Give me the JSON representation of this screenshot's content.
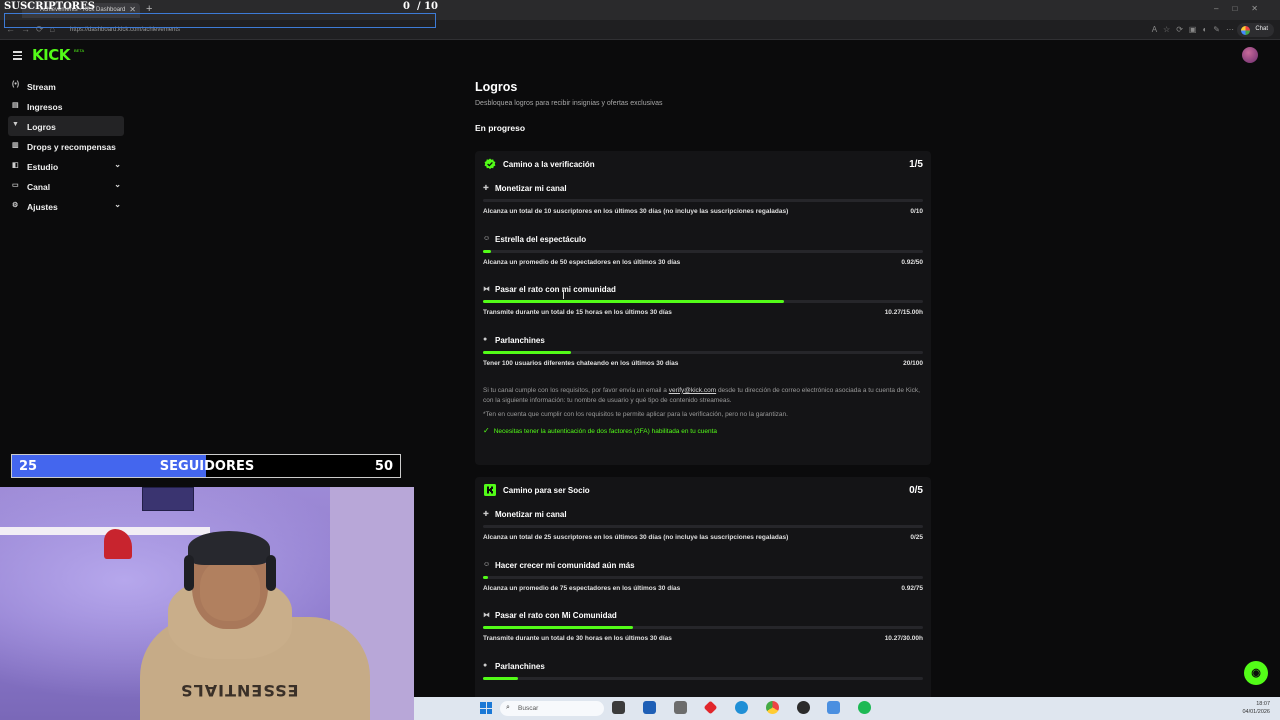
{
  "overlay_subs": {
    "label": "SUSCRIPTORES",
    "current": "0",
    "sep": "/",
    "goal": "10"
  },
  "browser": {
    "tab_title": "Achievements - Kick Dashboard",
    "url": "https://dashboard.kick.com/achievements",
    "chat_label": "Chat"
  },
  "kick": {
    "logo": "KICK",
    "logo_beta": "BETA"
  },
  "sidebar": {
    "items": [
      {
        "label": "Stream",
        "icon": "broadcast-icon",
        "glyph": "((•))"
      },
      {
        "label": "Ingresos",
        "icon": "wallet-icon",
        "glyph": "▤"
      },
      {
        "label": "Logros",
        "icon": "trophy-icon",
        "glyph": "🏆"
      },
      {
        "label": "Drops y recompensas",
        "icon": "gift-icon",
        "glyph": "▥"
      },
      {
        "label": "Estudio",
        "icon": "studio-icon",
        "glyph": "◧"
      },
      {
        "label": "Canal",
        "icon": "channel-icon",
        "glyph": "▭"
      },
      {
        "label": "Ajustes",
        "icon": "gear-icon",
        "glyph": "⚙"
      }
    ]
  },
  "page": {
    "title": "Logros",
    "subtitle": "Desbloquea logros para recibir insignias y ofertas exclusivas",
    "section": "En progreso"
  },
  "cards": [
    {
      "title": "Camino a la verificación",
      "count": "1/5",
      "badge_color": "#53fc18",
      "tasks": [
        {
          "name": "Monetizar mi canal",
          "icon": "✚",
          "desc": "Alcanza un total de 10 suscriptores en los últimos 30 días (no incluye las suscripciones regaladas)",
          "value": "0/10",
          "progress": 0.0
        },
        {
          "name": "Estrella del espectáculo",
          "icon": "☺",
          "desc": "Alcanza un promedio de 50 espectadores en los últimos 30 días",
          "value": "0.92/50",
          "progress": 0.018
        },
        {
          "name": "Pasar el rato con mi comunidad",
          "icon": "⧓",
          "desc": "Transmite durante un total de 15 horas en los últimos 30 días",
          "value": "10.27/15.00h",
          "progress": 0.685
        },
        {
          "name": "Parlanchines",
          "icon": "●",
          "desc": "Tener 100 usuarios diferentes chateando en los últimos 30 días",
          "value": "20/100",
          "progress": 0.2
        }
      ],
      "info": {
        "text1": "Si tu canal cumple con los requisitos, por favor envía un email a ",
        "email": "verify@kick.com",
        "text2": " desde tu dirección de correo electrónico asociada a tu cuenta de Kick, con la siguiente información: tu nombre de usuario y qué tipo de contenido streameas.",
        "note": "*Ten en cuenta que cumplir con los requisitos te permite aplicar para la verificación, pero no la garantizan.",
        "twofa": "Necesitas tener la autenticación de dos factores (2FA) habilitada en tu cuenta"
      }
    },
    {
      "title": "Camino para ser Socio",
      "count": "0/5",
      "badge_color": "#53fc18",
      "tasks": [
        {
          "name": "Monetizar mi canal",
          "icon": "✚",
          "desc": "Alcanza un total de 25 suscriptores en los últimos 30 días (no incluye las suscripciones regaladas)",
          "value": "0/25",
          "progress": 0.0
        },
        {
          "name": "Hacer crecer mi comunidad aún más",
          "icon": "☺",
          "desc": "Alcanza un promedio de 75 espectadores en los últimos 30 días",
          "value": "0.92/75",
          "progress": 0.012
        },
        {
          "name": "Pasar el rato con Mi Comunidad",
          "icon": "⧓",
          "desc": "Transmite durante un total de 30 horas en los últimos 30 días",
          "value": "10.27/30.00h",
          "progress": 0.342
        },
        {
          "name": "Parlanchines",
          "icon": "●",
          "desc": "",
          "value": "",
          "progress": 0.08
        }
      ]
    }
  ],
  "overlay_followers": {
    "current": "25",
    "label": "SEGUIDORES",
    "goal": "50",
    "progress": 0.5
  },
  "webcam": {
    "hoodie_text": "ESSENTIALS"
  },
  "taskbar": {
    "search_placeholder": "Buscar",
    "time": "18:07",
    "date": "04/01/2026"
  }
}
